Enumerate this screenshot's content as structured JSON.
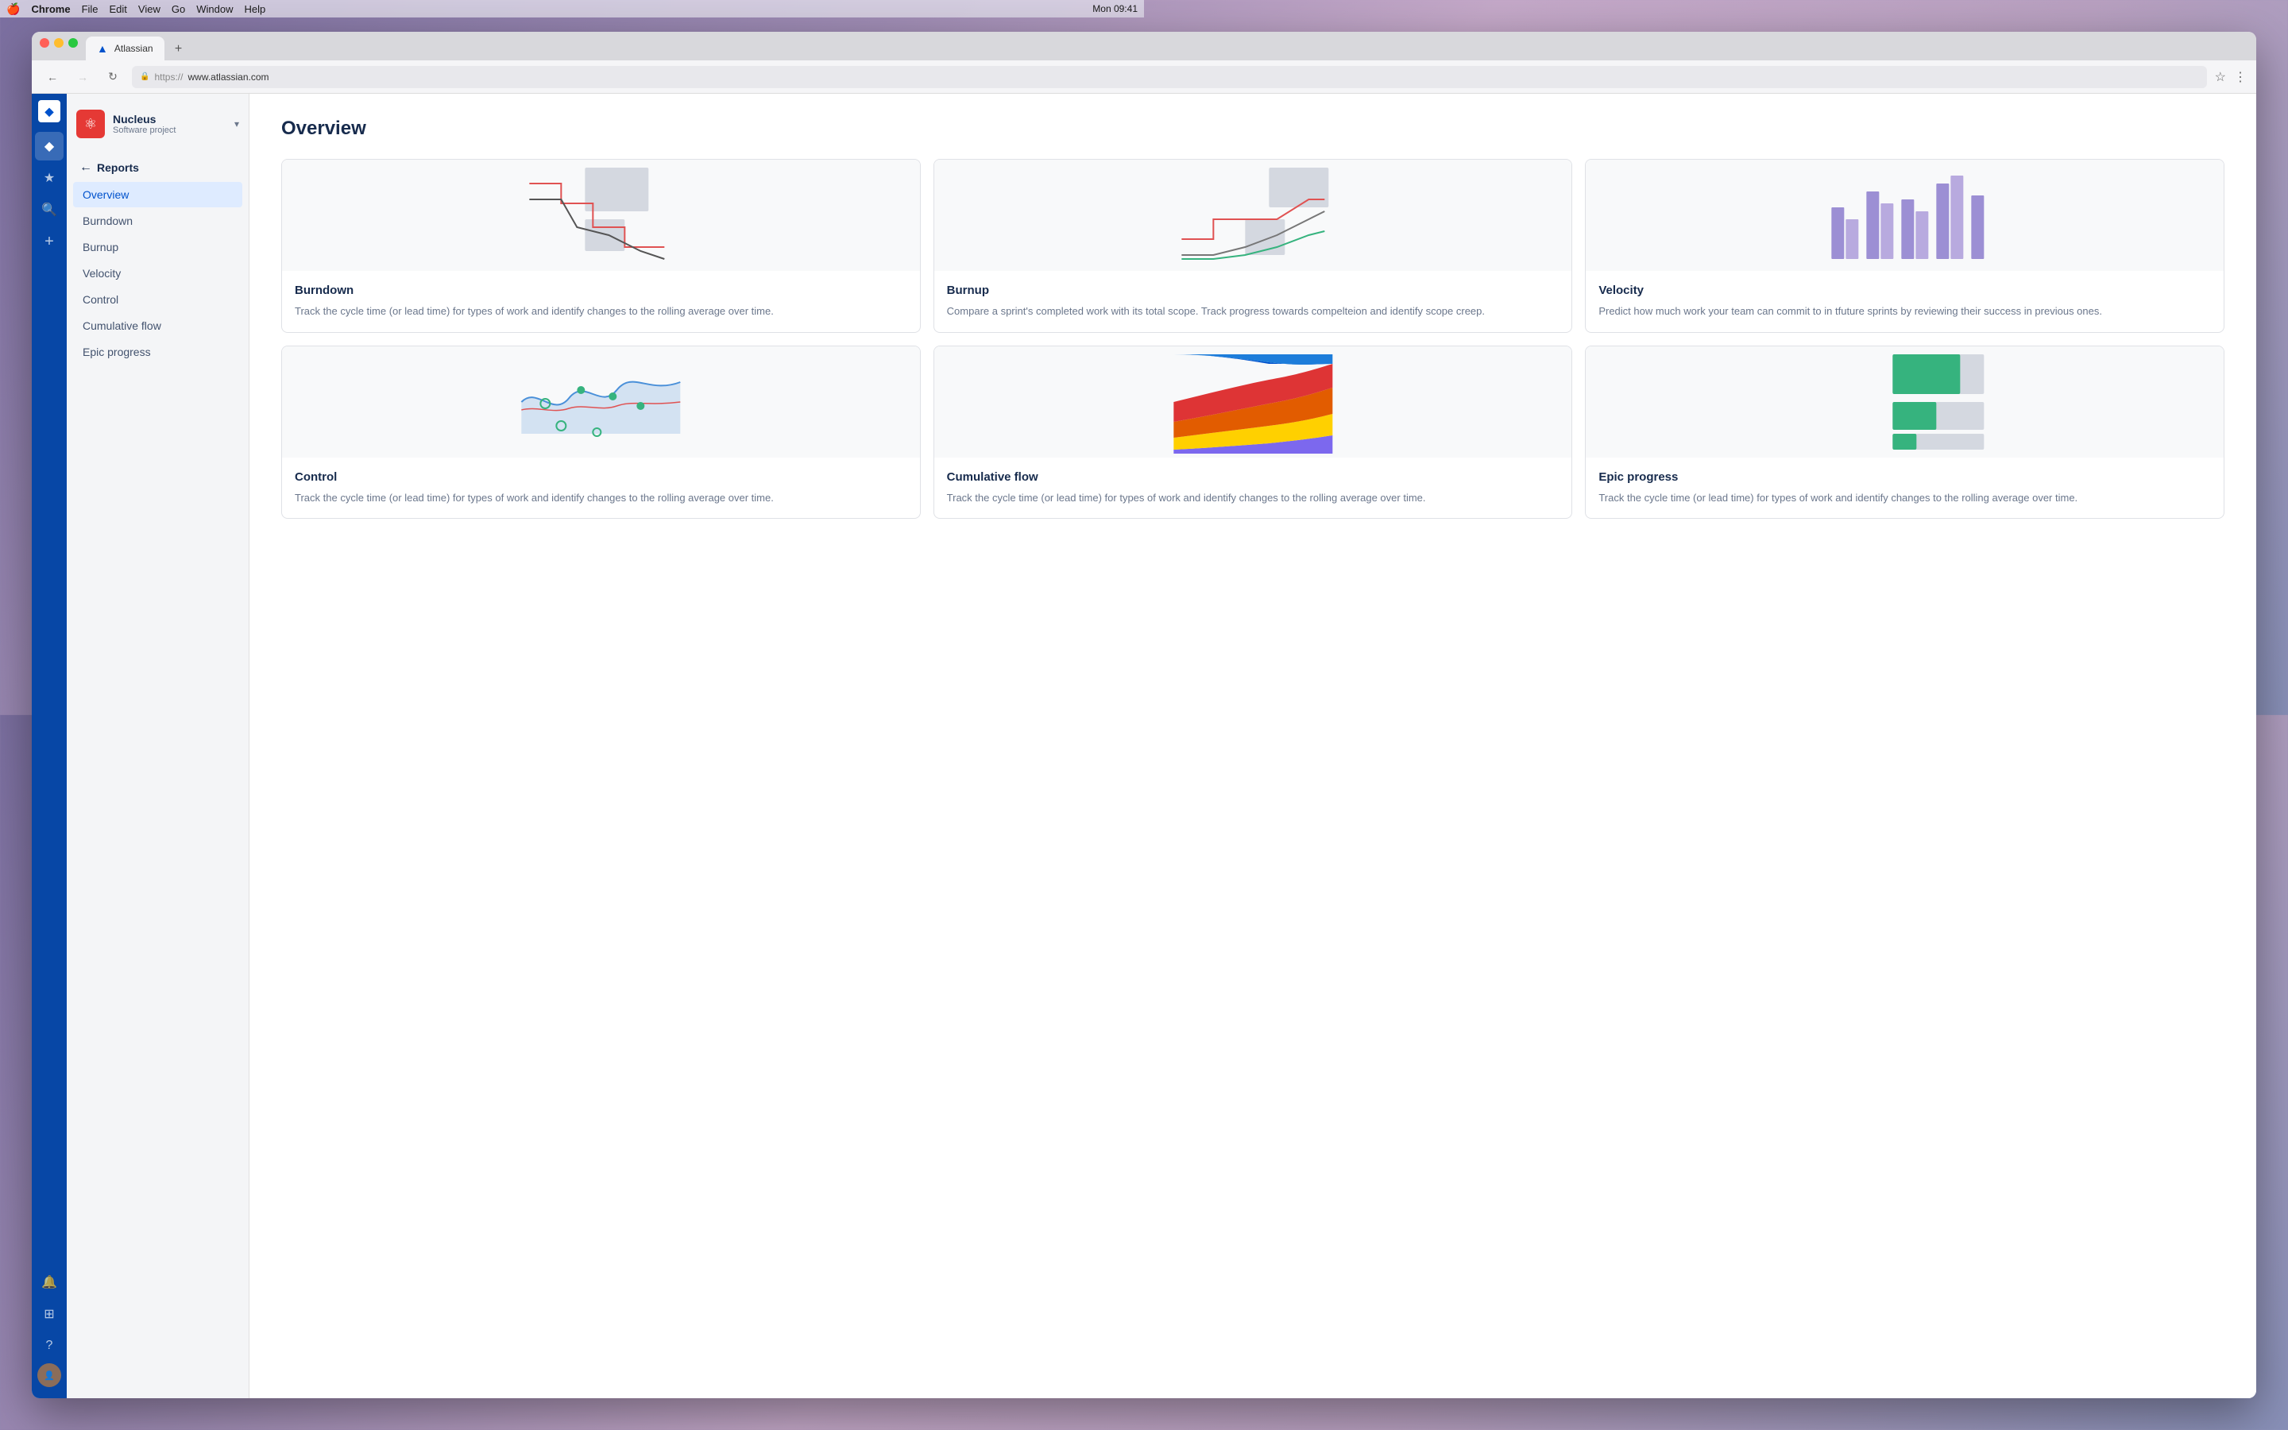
{
  "menubar": {
    "apple": "🍎",
    "items": [
      "Chrome",
      "File",
      "Edit",
      "View",
      "Go",
      "Window",
      "Help"
    ],
    "time": "Mon 09:41",
    "chrome_bold": true
  },
  "browser": {
    "tab_label": "Atlassian",
    "url_protocol": "https://",
    "url_domain": "www.atlassian.com",
    "add_tab": "+"
  },
  "nav_rail": {
    "logo_symbol": "◆",
    "icons": [
      "★",
      "🔍",
      "+",
      "🔔",
      "⊞",
      "?"
    ]
  },
  "sidebar": {
    "project_name": "Nucleus",
    "project_type": "Software project",
    "back_label": "Reports",
    "nav_items": [
      {
        "label": "Overview",
        "active": true
      },
      {
        "label": "Burndown",
        "active": false
      },
      {
        "label": "Burnup",
        "active": false
      },
      {
        "label": "Velocity",
        "active": false
      },
      {
        "label": "Control",
        "active": false
      },
      {
        "label": "Cumulative flow",
        "active": false
      },
      {
        "label": "Epic progress",
        "active": false
      }
    ]
  },
  "main": {
    "title": "Overview",
    "cards": [
      {
        "id": "burndown",
        "title": "Burndown",
        "description": "Track the cycle time (or lead time) for types of work and identify changes to the rolling average over time.",
        "chart_type": "burndown"
      },
      {
        "id": "burnup",
        "title": "Burnup",
        "description": "Compare a sprint's completed work with its total scope. Track progress towards compelteion and identify scope creep.",
        "chart_type": "burnup"
      },
      {
        "id": "velocity",
        "title": "Velocity",
        "description": "Predict how much work your team can commit to in tfuture sprints by reviewing their success in previous ones.",
        "chart_type": "velocity"
      },
      {
        "id": "control",
        "title": "Control",
        "description": "Track the cycle time (or lead time) for types of work and identify changes to the rolling average over time.",
        "chart_type": "control"
      },
      {
        "id": "cumulative-flow",
        "title": "Cumulative flow",
        "description": "Track the cycle time (or lead time) for types of work and identify changes to the rolling average over time.",
        "chart_type": "cumulative"
      },
      {
        "id": "epic-progress",
        "title": "Epic progress",
        "description": "Track the cycle time (or lead time) for types of work and identify changes to the rolling average over time.",
        "chart_type": "epic"
      }
    ]
  }
}
